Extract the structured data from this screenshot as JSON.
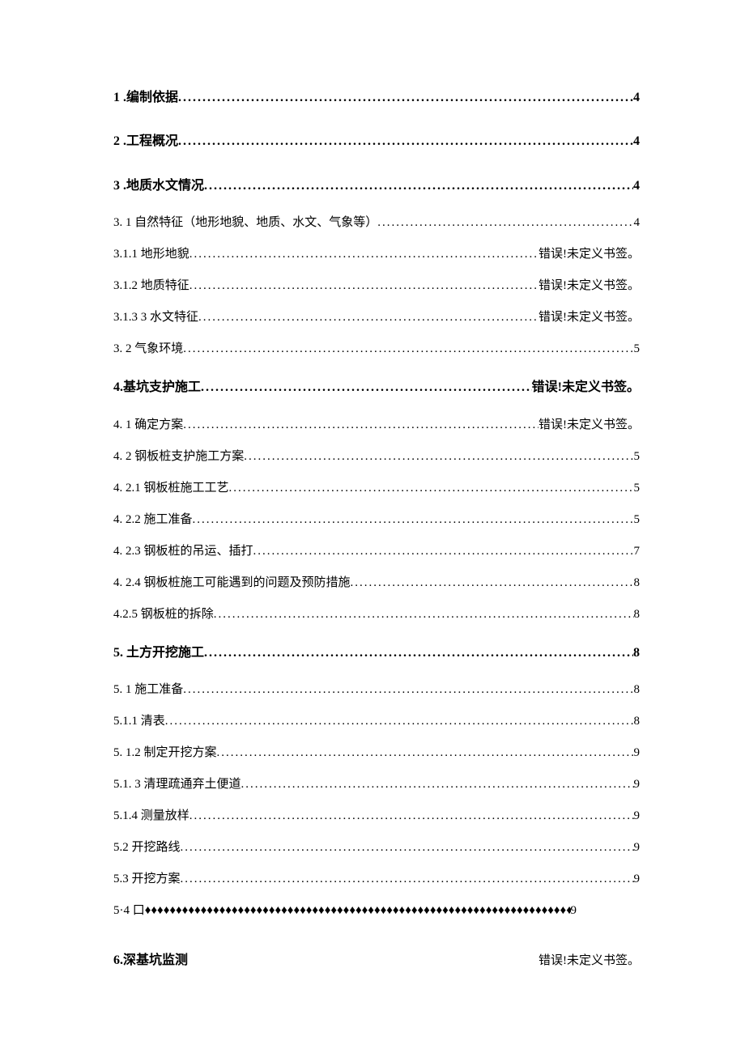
{
  "toc": {
    "entries": [
      {
        "label": "1 .编制依据 ",
        "page": "4",
        "level": 1,
        "leader": "dots"
      },
      {
        "label": "2 .工程概况 ",
        "page": "4",
        "level": 1,
        "leader": "dots"
      },
      {
        "label": "3 .地质水文情况 ",
        "page": "4",
        "level": 1,
        "leader": "dots"
      },
      {
        "label": "3.  1 自然特征（地形地貌、地质、水文、气象等） ",
        "page": "4",
        "level": 2,
        "leader": "dots"
      },
      {
        "label": "3.1.1  地形地貌",
        "page": "错误!未定义书签。",
        "level": 3,
        "leader": "dots"
      },
      {
        "label": "3.1.2  地质特征",
        "page": "错误!未定义书签。",
        "level": 3,
        "leader": "dots"
      },
      {
        "label": "3.1.3 3 水文特征",
        "page": "错误!未定义书签。",
        "level": 3,
        "leader": "dots"
      },
      {
        "label": "3.  2 气象环境 ",
        "page": "5",
        "level": 2,
        "leader": "dots"
      },
      {
        "label": "4.基坑支护施工",
        "page": " 错误!未定义书签。",
        "level": 1,
        "leader": "dots"
      },
      {
        "label": "4.  1 确定方案",
        "page": "错误!未定义书签。",
        "level": 2,
        "leader": "dots"
      },
      {
        "label": "4.  2 钢板桩支护施工方案 ",
        "page": "5",
        "level": 2,
        "leader": "dots"
      },
      {
        "label": "4.  2.1 钢板桩施工工艺 ",
        "page": "5",
        "level": 3,
        "leader": "dots"
      },
      {
        "label": "4.  2.2 施工准备 ",
        "page": "5",
        "level": 3,
        "leader": "dots"
      },
      {
        "label": "4.  2.3 钢板桩的吊运、插打 ",
        "page": "7",
        "level": 3,
        "leader": "dots"
      },
      {
        "label": "4.  2.4 钢板桩施工可能遇到的问题及预防措施",
        "page": "8",
        "level": 3,
        "leader": "dots"
      },
      {
        "label": "4.2.5 钢板桩的拆除",
        "page": "8",
        "level": 3,
        "leader": "dots"
      },
      {
        "label": "5.  土方开挖施工 ",
        "page": "8",
        "level": 1,
        "leader": "dots"
      },
      {
        "label": "5.  1 施工准备 ",
        "page": "8",
        "level": 2,
        "leader": "dots"
      },
      {
        "label": "5.1.1 清表 ",
        "page": "8",
        "level": 3,
        "leader": "dots"
      },
      {
        "label": "5.  1.2 制定开挖方案",
        "page": "9",
        "level": 3,
        "leader": "dots"
      },
      {
        "label": "5.1.  3 清理疏通弃土便道",
        "page": "9",
        "level": 3,
        "leader": "dots"
      },
      {
        "label": "5.1.4 测量放样 ",
        "page": "9",
        "level": 3,
        "leader": "dots"
      },
      {
        "label": "5.2 开挖路线 ",
        "page": "9",
        "level": 2,
        "leader": "dots"
      },
      {
        "label": "5.3 开挖方案 ",
        "page": "9",
        "level": 2,
        "leader": "dots"
      }
    ],
    "diamond_entry": {
      "label": "5·4 口",
      "page": "9"
    },
    "last_entry": {
      "label": "6.深基坑监测",
      "page": "错误!未定义书签。"
    }
  }
}
